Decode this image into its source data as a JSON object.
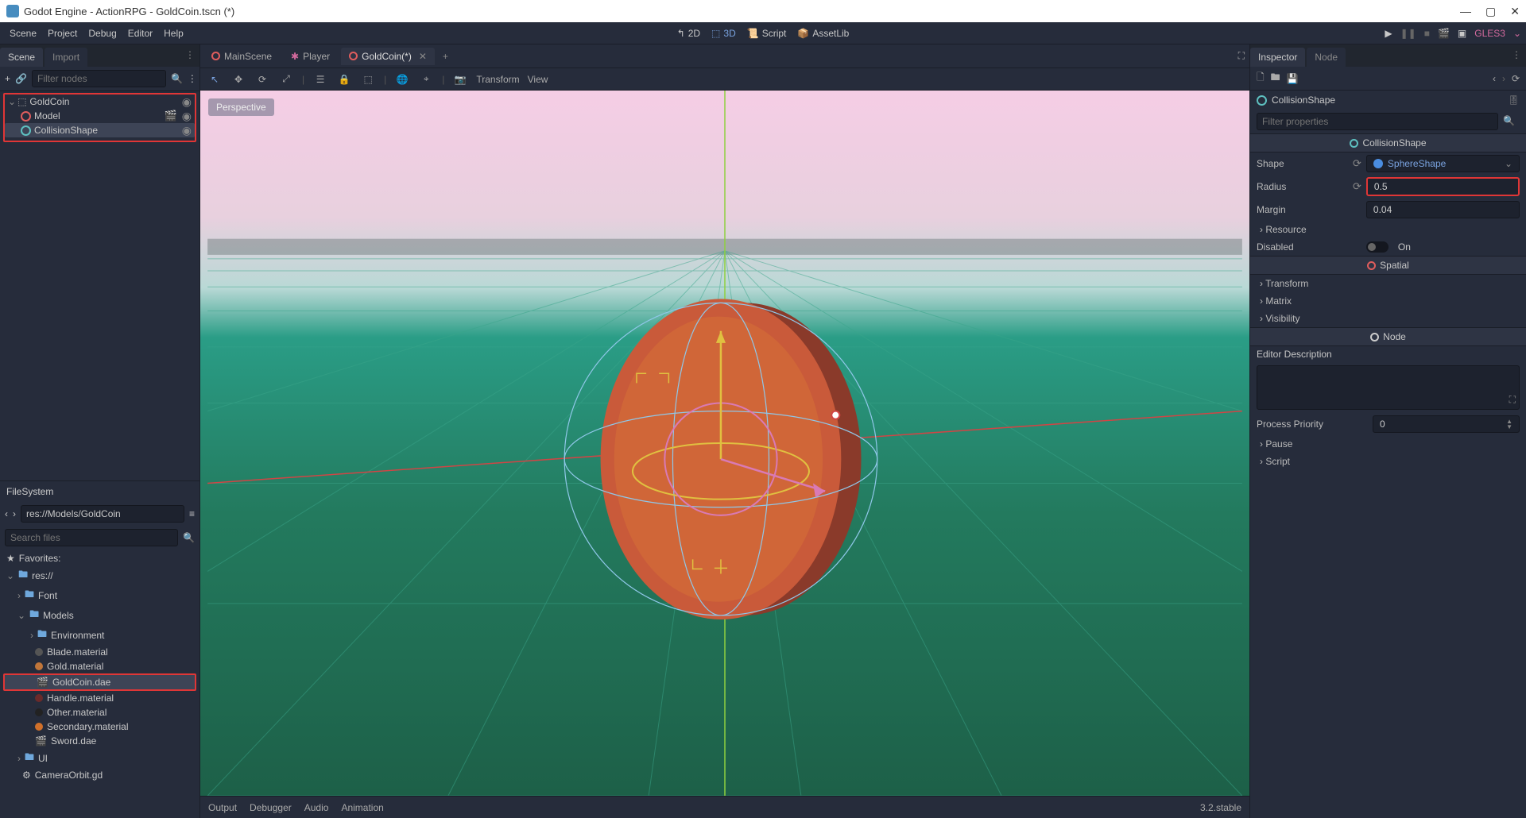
{
  "window": {
    "title": "Godot Engine - ActionRPG - GoldCoin.tscn (*)"
  },
  "menubar": {
    "scene": "Scene",
    "project": "Project",
    "debug": "Debug",
    "editor": "Editor",
    "help": "Help"
  },
  "mode": {
    "d2": "2D",
    "d3": "3D",
    "script": "Script",
    "assetlib": "AssetLib"
  },
  "render": "GLES3",
  "left": {
    "scene_tab": "Scene",
    "import_tab": "Import",
    "filter_placeholder": "Filter nodes",
    "tree": {
      "root": "GoldCoin",
      "model": "Model",
      "collision": "CollisionShape"
    },
    "fs_title": "FileSystem",
    "fs_path": "res://Models/GoldCoin",
    "search_placeholder": "Search files",
    "favorites": "Favorites:",
    "res": "res://",
    "font": "Font",
    "models": "Models",
    "environment": "Environment",
    "blade": "Blade.material",
    "gold": "Gold.material",
    "goldcoin": "GoldCoin.dae",
    "handle": "Handle.material",
    "other": "Other.material",
    "secondary": "Secondary.material",
    "sword": "Sword.dae",
    "ui": "UI",
    "camera": "CameraOrbit.gd"
  },
  "tabs": {
    "main": "MainScene",
    "player": "Player",
    "goldcoin": "GoldCoin(*)"
  },
  "vtb": {
    "transform": "Transform",
    "view": "View",
    "perspective": "Perspective"
  },
  "bottom": {
    "output": "Output",
    "debugger": "Debugger",
    "audio": "Audio",
    "animation": "Animation",
    "version": "3.2.stable"
  },
  "inspector": {
    "tab1": "Inspector",
    "tab2": "Node",
    "node_name": "CollisionShape",
    "filter_placeholder": "Filter properties",
    "section_collision": "CollisionShape",
    "shape_label": "Shape",
    "shape_value": "SphereShape",
    "radius_label": "Radius",
    "radius_value": "0.5",
    "margin_label": "Margin",
    "margin_value": "0.04",
    "resource": "Resource",
    "disabled_label": "Disabled",
    "disabled_on": "On",
    "section_spatial": "Spatial",
    "transform": "Transform",
    "matrix": "Matrix",
    "visibility": "Visibility",
    "section_node": "Node",
    "editor_desc": "Editor Description",
    "priority_label": "Process Priority",
    "priority_value": "0",
    "pause": "Pause",
    "script": "Script"
  }
}
